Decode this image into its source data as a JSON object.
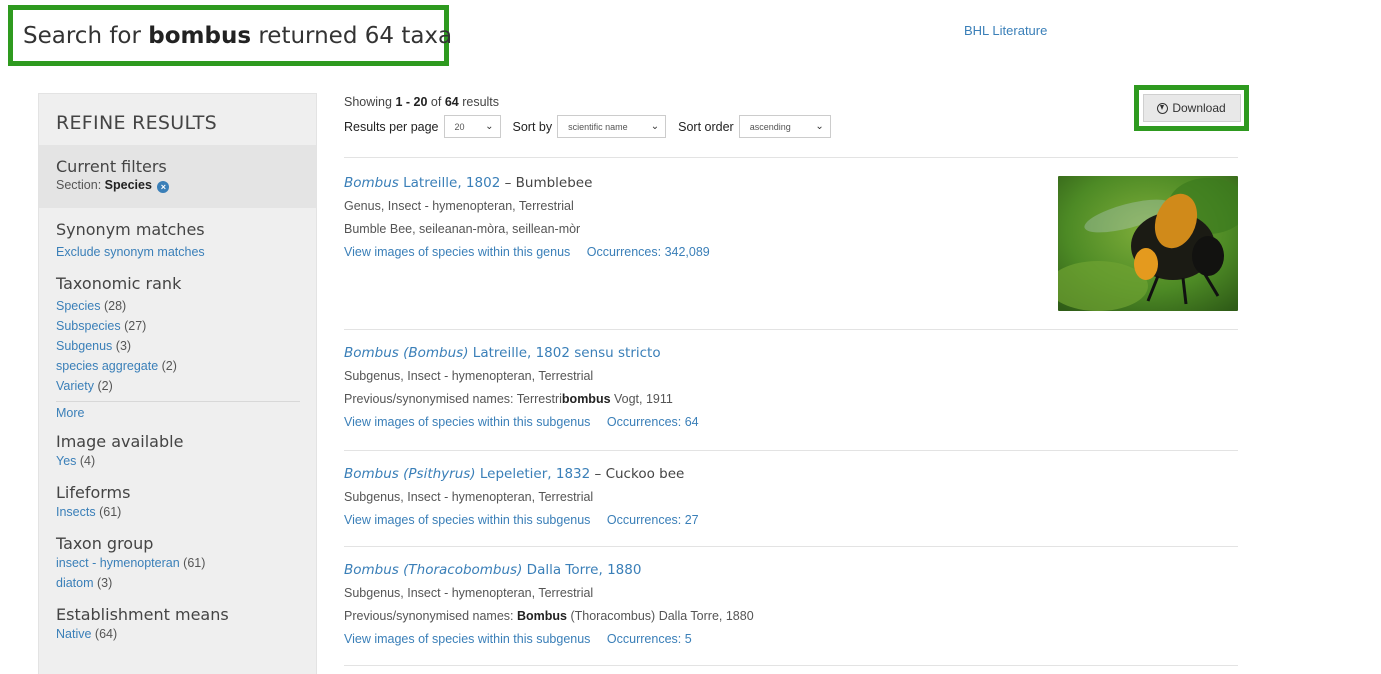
{
  "header": {
    "search_prefix": "Search for",
    "search_term": "bombus",
    "search_suffix": "returned 64 taxa",
    "bhl_link": "BHL Literature"
  },
  "sidebar": {
    "title": "REFINE RESULTS",
    "current_filters": {
      "title": "Current filters",
      "label": "Section:",
      "value": "Species"
    },
    "synonym": {
      "title": "Synonym matches",
      "link": "Exclude synonym matches"
    },
    "rank": {
      "title": "Taxonomic rank",
      "items": [
        {
          "label": "Species",
          "count": "(28)"
        },
        {
          "label": "Subspecies",
          "count": "(27)"
        },
        {
          "label": "Subgenus",
          "count": "(3)"
        },
        {
          "label": "species aggregate",
          "count": "(2)"
        },
        {
          "label": "Variety",
          "count": "(2)"
        }
      ],
      "more": "More"
    },
    "image": {
      "title": "Image available",
      "items": [
        {
          "label": "Yes",
          "count": "(4)"
        }
      ]
    },
    "lifeforms": {
      "title": "Lifeforms",
      "items": [
        {
          "label": "Insects",
          "count": "(61)"
        }
      ]
    },
    "taxon_group": {
      "title": "Taxon group",
      "items": [
        {
          "label": "insect - hymenopteran",
          "count": "(61)"
        },
        {
          "label": "diatom",
          "count": "(3)"
        }
      ]
    },
    "establishment": {
      "title": "Establishment means",
      "items": [
        {
          "label": "Native",
          "count": "(64)"
        }
      ]
    }
  },
  "results_meta": {
    "showing": "Showing",
    "range": "1 - 20",
    "of": "of",
    "total": "64",
    "results": "results"
  },
  "controls": {
    "per_page_label": "Results per page",
    "per_page_value": "20",
    "sort_by_label": "Sort by",
    "sort_by_value": "scientific name",
    "sort_order_label": "Sort order",
    "sort_order_value": "ascending"
  },
  "download": {
    "label": "Download"
  },
  "results": [
    {
      "name_italic": "Bombus",
      "authority": "Latreille, 1802",
      "common": "– Bumblebee",
      "line1": "Genus, Insect - hymenopteran, Terrestrial",
      "line2": "Bumble Bee, seileanan-mòra, seillean-mòr",
      "images_link": "View images of species within this genus",
      "occurrences": "Occurrences: 342,089"
    },
    {
      "name_italic": "Bombus (Bombus)",
      "authority": "Latreille, 1802 sensu stricto",
      "line1": "Subgenus, Insect - hymenopteran, Terrestrial",
      "syn_prefix": "Previous/synonymised names: Terrestri",
      "syn_bold": "bombus",
      "syn_suffix": " Vogt, 1911",
      "images_link": "View images of species within this subgenus",
      "occurrences": "Occurrences: 64"
    },
    {
      "name_italic": "Bombus (Psithyrus)",
      "authority": "Lepeletier, 1832",
      "common": "– Cuckoo bee",
      "line1": "Subgenus, Insect - hymenopteran, Terrestrial",
      "images_link": "View images of species within this subgenus",
      "occurrences": "Occurrences: 27"
    },
    {
      "name_italic": "Bombus (Thoracobombus)",
      "authority": "Dalla Torre, 1880",
      "line1": "Subgenus, Insect - hymenopteran, Terrestrial",
      "syn_prefix": "Previous/synonymised names: ",
      "syn_bold": "Bombus",
      "syn_suffix": " (Thoracombus) Dalla Torre, 1880",
      "images_link": "View images of species within this subgenus",
      "occurrences": "Occurrences: 5"
    }
  ],
  "colors": {
    "highlight": "#2e9a1f",
    "link": "#3a7fb8"
  }
}
